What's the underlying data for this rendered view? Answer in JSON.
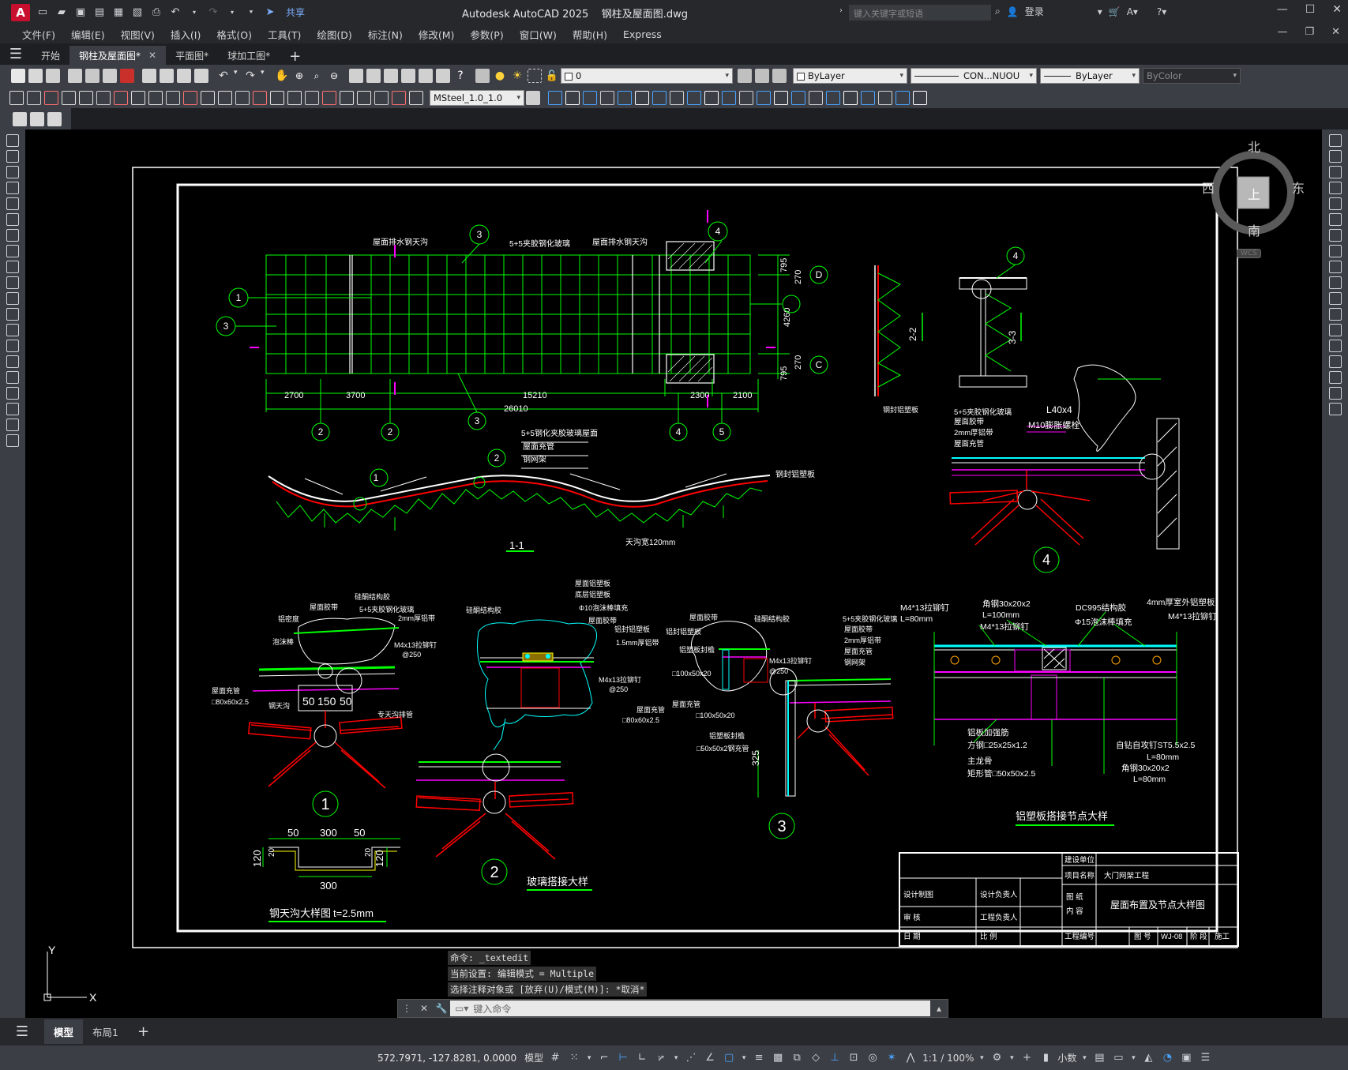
{
  "app": {
    "logo": "A",
    "title": "Autodesk AutoCAD 2025",
    "filename": "钢柱及屋面图.dwg",
    "share_label": "共享",
    "search_placeholder": "键入关键字或短语",
    "login_label": "登录"
  },
  "menu": [
    "文件(F)",
    "编辑(E)",
    "视图(V)",
    "插入(I)",
    "格式(O)",
    "工具(T)",
    "绘图(D)",
    "标注(N)",
    "修改(M)",
    "参数(P)",
    "窗口(W)",
    "帮助(H)",
    "Express"
  ],
  "tabs": [
    {
      "label": "开始",
      "active": false
    },
    {
      "label": "钢柱及屋面图*",
      "active": true
    },
    {
      "label": "平面图*",
      "active": false
    },
    {
      "label": "球加工图*",
      "active": false
    }
  ],
  "toolbar": {
    "layer_value": "0",
    "color_value": "ByLayer",
    "linetype_value": "CON...NUOU",
    "lineweight_value": "ByLayer",
    "plotstyle_value": "ByColor",
    "dimstyle_value": "MSteel_1.0_1.0"
  },
  "viewcube": {
    "north": "北",
    "south": "南",
    "east": "东",
    "west": "西",
    "top": "上",
    "wcs": "WCS"
  },
  "command": {
    "history": [
      "命令: _textedit",
      "当前设置: 编辑模式 = Multiple",
      "选择注释对象或 [放弃(U)/模式(M)]: *取消*"
    ],
    "placeholder": "键入命令"
  },
  "layouts": [
    {
      "label": "模型",
      "active": true
    },
    {
      "label": "布局1",
      "active": false
    }
  ],
  "status": {
    "coords": "572.7971, -127.8281, 0.0000",
    "model": "模型",
    "scale": "1:1 / 100%",
    "units": "小数"
  },
  "drawing": {
    "plan_labels": {
      "gutter1": "屋面排水钢天沟",
      "glass": "5+5夹胶钢化玻璃",
      "gutter2": "屋面排水钢天沟",
      "dims_bottom": [
        "2700",
        "3700",
        "15210",
        "2300",
        "2100"
      ],
      "dim_total": "26010",
      "dims_right": [
        "795",
        "270",
        "4260",
        "270",
        "795"
      ],
      "axis_right": [
        "D",
        "C"
      ],
      "bubbles_bottom": [
        "2",
        "2",
        "3",
        "4",
        "5"
      ]
    },
    "section_labels": {
      "title": "1-1",
      "roof_note": "5+5钢化夹胶玻璃屋面",
      "notes": [
        "屋面充管",
        "钢网架"
      ],
      "gutter_note": "钢封铝塑板",
      "gutter_width": "天沟宽120mm"
    },
    "details": {
      "d4_labels": [
        "5+5夹胶钢化玻璃",
        "屋面胶带",
        "2mm厚铝带",
        "屋面充管"
      ],
      "d4_bolt": "L40x4",
      "d4_anchor": "M10膨胀螺栓",
      "d1_labels": [
        "硅酮结构胶",
        "5+5夹胶钢化玻璃",
        "2mm厚铝带",
        "M4x13拉铆钉",
        "@250",
        "屋面胶带",
        "铝密度",
        "泡沫棒",
        "屋面充管",
        "□80x60x2.5",
        "钢天沟",
        "专天沟排管"
      ],
      "d1_dims": [
        "50",
        "150",
        "50"
      ],
      "d2_labels": [
        "屋面铝塑板",
        "底层铝塑板",
        "Φ10泡沫棒填充",
        "屋面胶带",
        "硅酮结构胶",
        "铝封铝塑板",
        "1.5mm厚铝带",
        "M4x13拉铆钉",
        "@250",
        "屋面充管",
        "□80x60x2.5"
      ],
      "d3_labels": [
        "硅酮结构胶",
        "5+5夹胶钢化玻璃",
        "屋面胶带",
        "2mm厚铝带",
        "屋面充管",
        "钢网架",
        "M4x13拉铆钉",
        "@250",
        "屋面胶带",
        "铝封铝塑板",
        "铝塑板封檐",
        "屋面充管",
        "□100x50x20",
        "铝塑板封檐",
        "□50x50x2钢充管"
      ],
      "d3_dim": "325",
      "gutter_dims": [
        "50",
        "300",
        "50",
        "120",
        "20",
        "20",
        "120",
        "300"
      ],
      "bubble_numbers": [
        "1",
        "2",
        "3",
        "4"
      ]
    },
    "titles": {
      "gutter": "钢天沟大样图",
      "gutter_thickness": "t=2.5mm",
      "glass_joint": "玻璃搭接大样",
      "panel_joint": "铝塑板搭接节点大样"
    },
    "panel_joint": {
      "labels": [
        "M4*13拉铆钉",
        "L=80mm",
        "角钢30x20x2",
        "L=100mm",
        "M4*13拉铆钉",
        "DC995结构胶",
        "Φ15泡沫棒填充",
        "4mm厚室外铝塑板",
        "M4*13拉铆钉",
        "铝板加强筋",
        "方钢□25x25x1.2",
        "主龙骨",
        "矩形管□50x50x2.5",
        "自钻自攻钉ST5.5x2.5",
        "L=80mm",
        "角钢30x20x2",
        "L=80mm"
      ]
    },
    "titleblock": {
      "build_unit": "建设单位",
      "project_name_label": "项目名称",
      "project_name": "大门网架工程",
      "drawing_label": "图 纸",
      "content_label": "内 容",
      "content": "屋面布置及节点大样图",
      "designer": "设计制图",
      "design_lead": "设计负责人",
      "review": "审 核",
      "eng_lead": "工程负责人",
      "date": "日 期",
      "scale": "比 例",
      "project_no": "工程编号",
      "sheet_label": "图 号",
      "sheet_no": "WJ-08",
      "stage_label": "阶 段",
      "stage": "施工"
    },
    "section_marks": [
      "3",
      "3",
      "1",
      "1",
      "2-2",
      "3-3"
    ],
    "ucs": {
      "y": "Y",
      "x": "X"
    }
  }
}
